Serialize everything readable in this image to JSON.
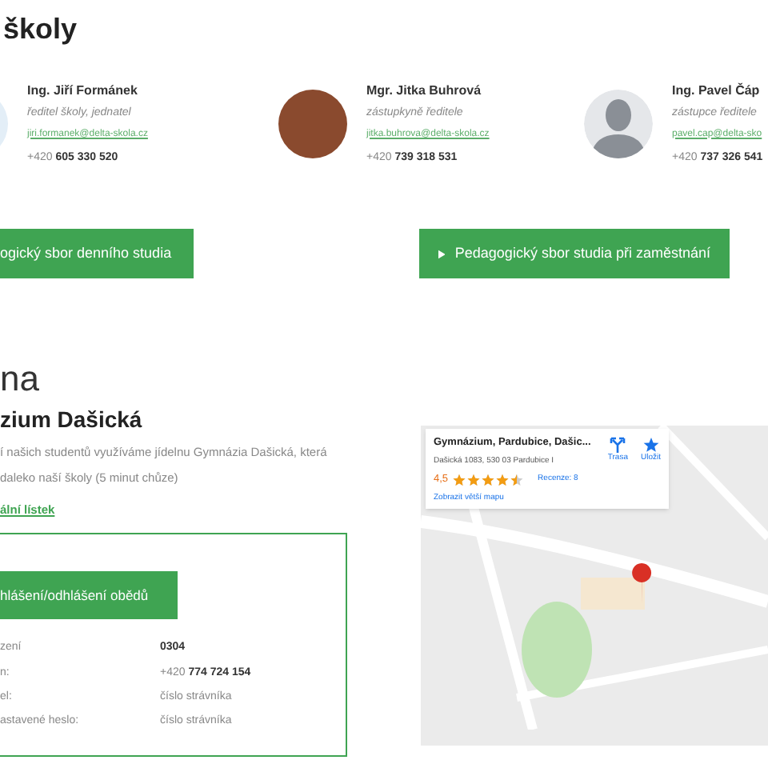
{
  "section_title": "školy",
  "people": [
    {
      "name": "Ing. Jiří Formánek",
      "role": "ředitel školy, jednatel",
      "email": "jiri.formanek@delta-skola.cz",
      "phone_prefix": "+420",
      "phone": "605 330 520",
      "kind": "logo"
    },
    {
      "name": "Mgr. Jitka Buhrová",
      "role": "zástupkyně ředitele",
      "email": "jitka.buhrova@delta-skola.cz",
      "phone_prefix": "+420",
      "phone": "739 318 531",
      "kind": "photo"
    },
    {
      "name": "Ing. Pavel Čáp",
      "role": "zástupce ředitele",
      "email": "pavel.cap@delta-sko",
      "phone_prefix": "+420",
      "phone": "737 326 541",
      "kind": "silhouette"
    }
  ],
  "staff_buttons": [
    {
      "label": "ogický sbor denního studia",
      "arrow": false
    },
    {
      "label": "Pedagogický sbor studia při zaměstnání",
      "arrow": true
    }
  ],
  "canteen": {
    "heading": "na",
    "subheading": "zium Dašická",
    "description_lines": [
      "í našich studentů využíváme jídelnu Gymnázia Dašická, která",
      "daleko naší školy (5 minut chůze)"
    ],
    "menu_link": "ální lístek",
    "order_button": "hlášení/odhlášení obědů",
    "rows": [
      {
        "label": "zení",
        "prefix": "",
        "value": "0304",
        "bold": true
      },
      {
        "label": "n:",
        "prefix": "+420",
        "value": "774 724 154",
        "bold": true
      },
      {
        "label": "el:",
        "prefix": "",
        "value": "číslo strávníka",
        "bold": false
      },
      {
        "label": "astavené heslo:",
        "prefix": "",
        "value": "číslo strávníka",
        "bold": false
      }
    ]
  },
  "map": {
    "place": "Gymnázium, Pardubice, Dašic...",
    "address": "Dašická 1083, 530 03 Pardubice I",
    "rating": "4,5",
    "stars": 4.5,
    "reviews": "Recenze: 8",
    "larger_map": "Zobrazit větší mapu",
    "directions": "Trasa",
    "save": "Uložit"
  }
}
